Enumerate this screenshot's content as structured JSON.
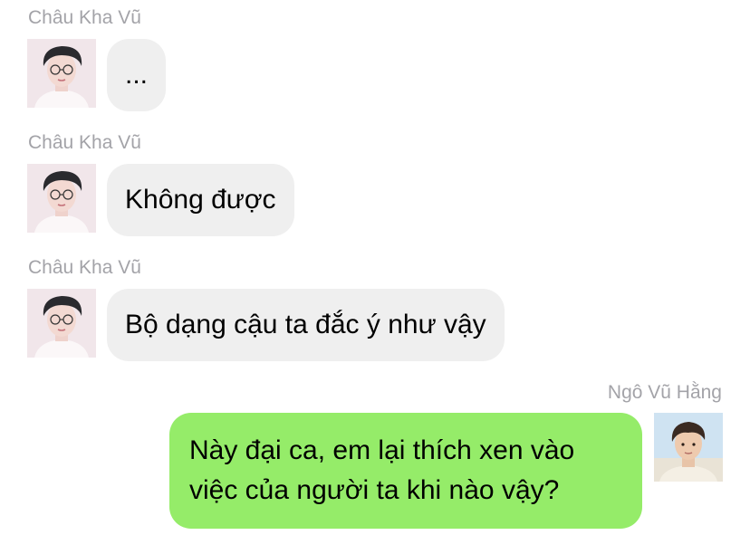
{
  "chat": {
    "messages": [
      {
        "sender": "Châu Kha Vũ",
        "text": "...",
        "direction": "incoming"
      },
      {
        "sender": "Châu Kha Vũ",
        "text": "Không được",
        "direction": "incoming"
      },
      {
        "sender": "Châu Kha Vũ",
        "text": "Bộ dạng cậu ta đắc ý như vậy",
        "direction": "incoming"
      },
      {
        "sender": "Ngô Vũ Hằng",
        "text": "Này đại ca, em lại thích xen vào việc của người ta khi nào vậy?",
        "direction": "outgoing"
      }
    ]
  },
  "colors": {
    "incoming_bubble": "#efefef",
    "outgoing_bubble": "#95ec69",
    "sender_name": "#a3a3a8"
  }
}
